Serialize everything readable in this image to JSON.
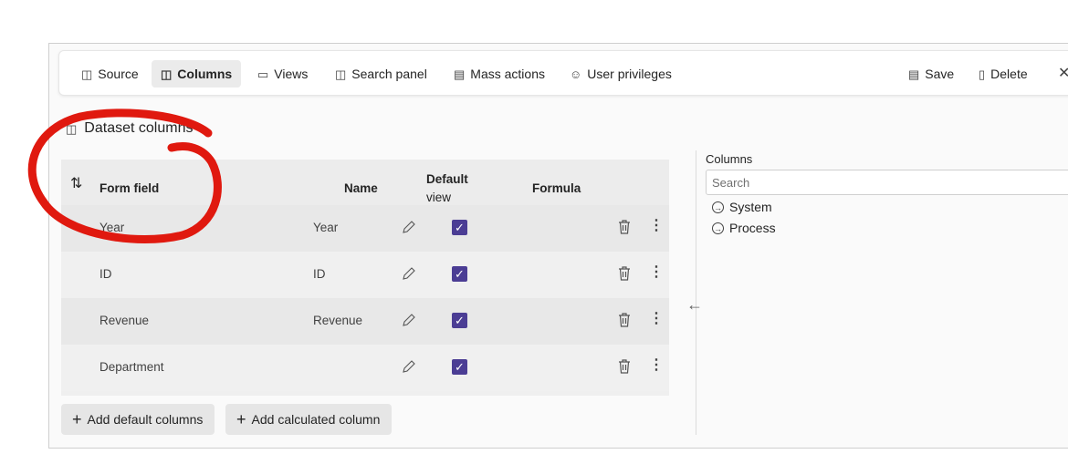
{
  "toolbar": {
    "source": "Source",
    "columns": "Columns",
    "views": "Views",
    "search_panel": "Search panel",
    "mass_actions": "Mass actions",
    "user_privileges": "User privileges",
    "save": "Save",
    "delete": "Delete"
  },
  "section_title": "Dataset columns",
  "table": {
    "headers": {
      "form_field": "Form field",
      "name": "Name",
      "default_view_line1": "Default",
      "default_view_line2": "view",
      "formula": "Formula"
    },
    "rows": [
      {
        "form_field": "Year",
        "name": "Year",
        "default_view": true
      },
      {
        "form_field": "ID",
        "name": "ID",
        "default_view": true
      },
      {
        "form_field": "Revenue",
        "name": "Revenue",
        "default_view": true
      },
      {
        "form_field": "Department",
        "name": "",
        "default_view": true
      }
    ]
  },
  "buttons": {
    "add_default": "Add default columns",
    "add_calculated": "Add calculated column"
  },
  "right_panel": {
    "label": "Columns",
    "search_placeholder": "Search",
    "tree": [
      "System",
      "Process"
    ]
  },
  "colors": {
    "checkbox": "#4b3d94",
    "annotation": "#e0190f"
  }
}
